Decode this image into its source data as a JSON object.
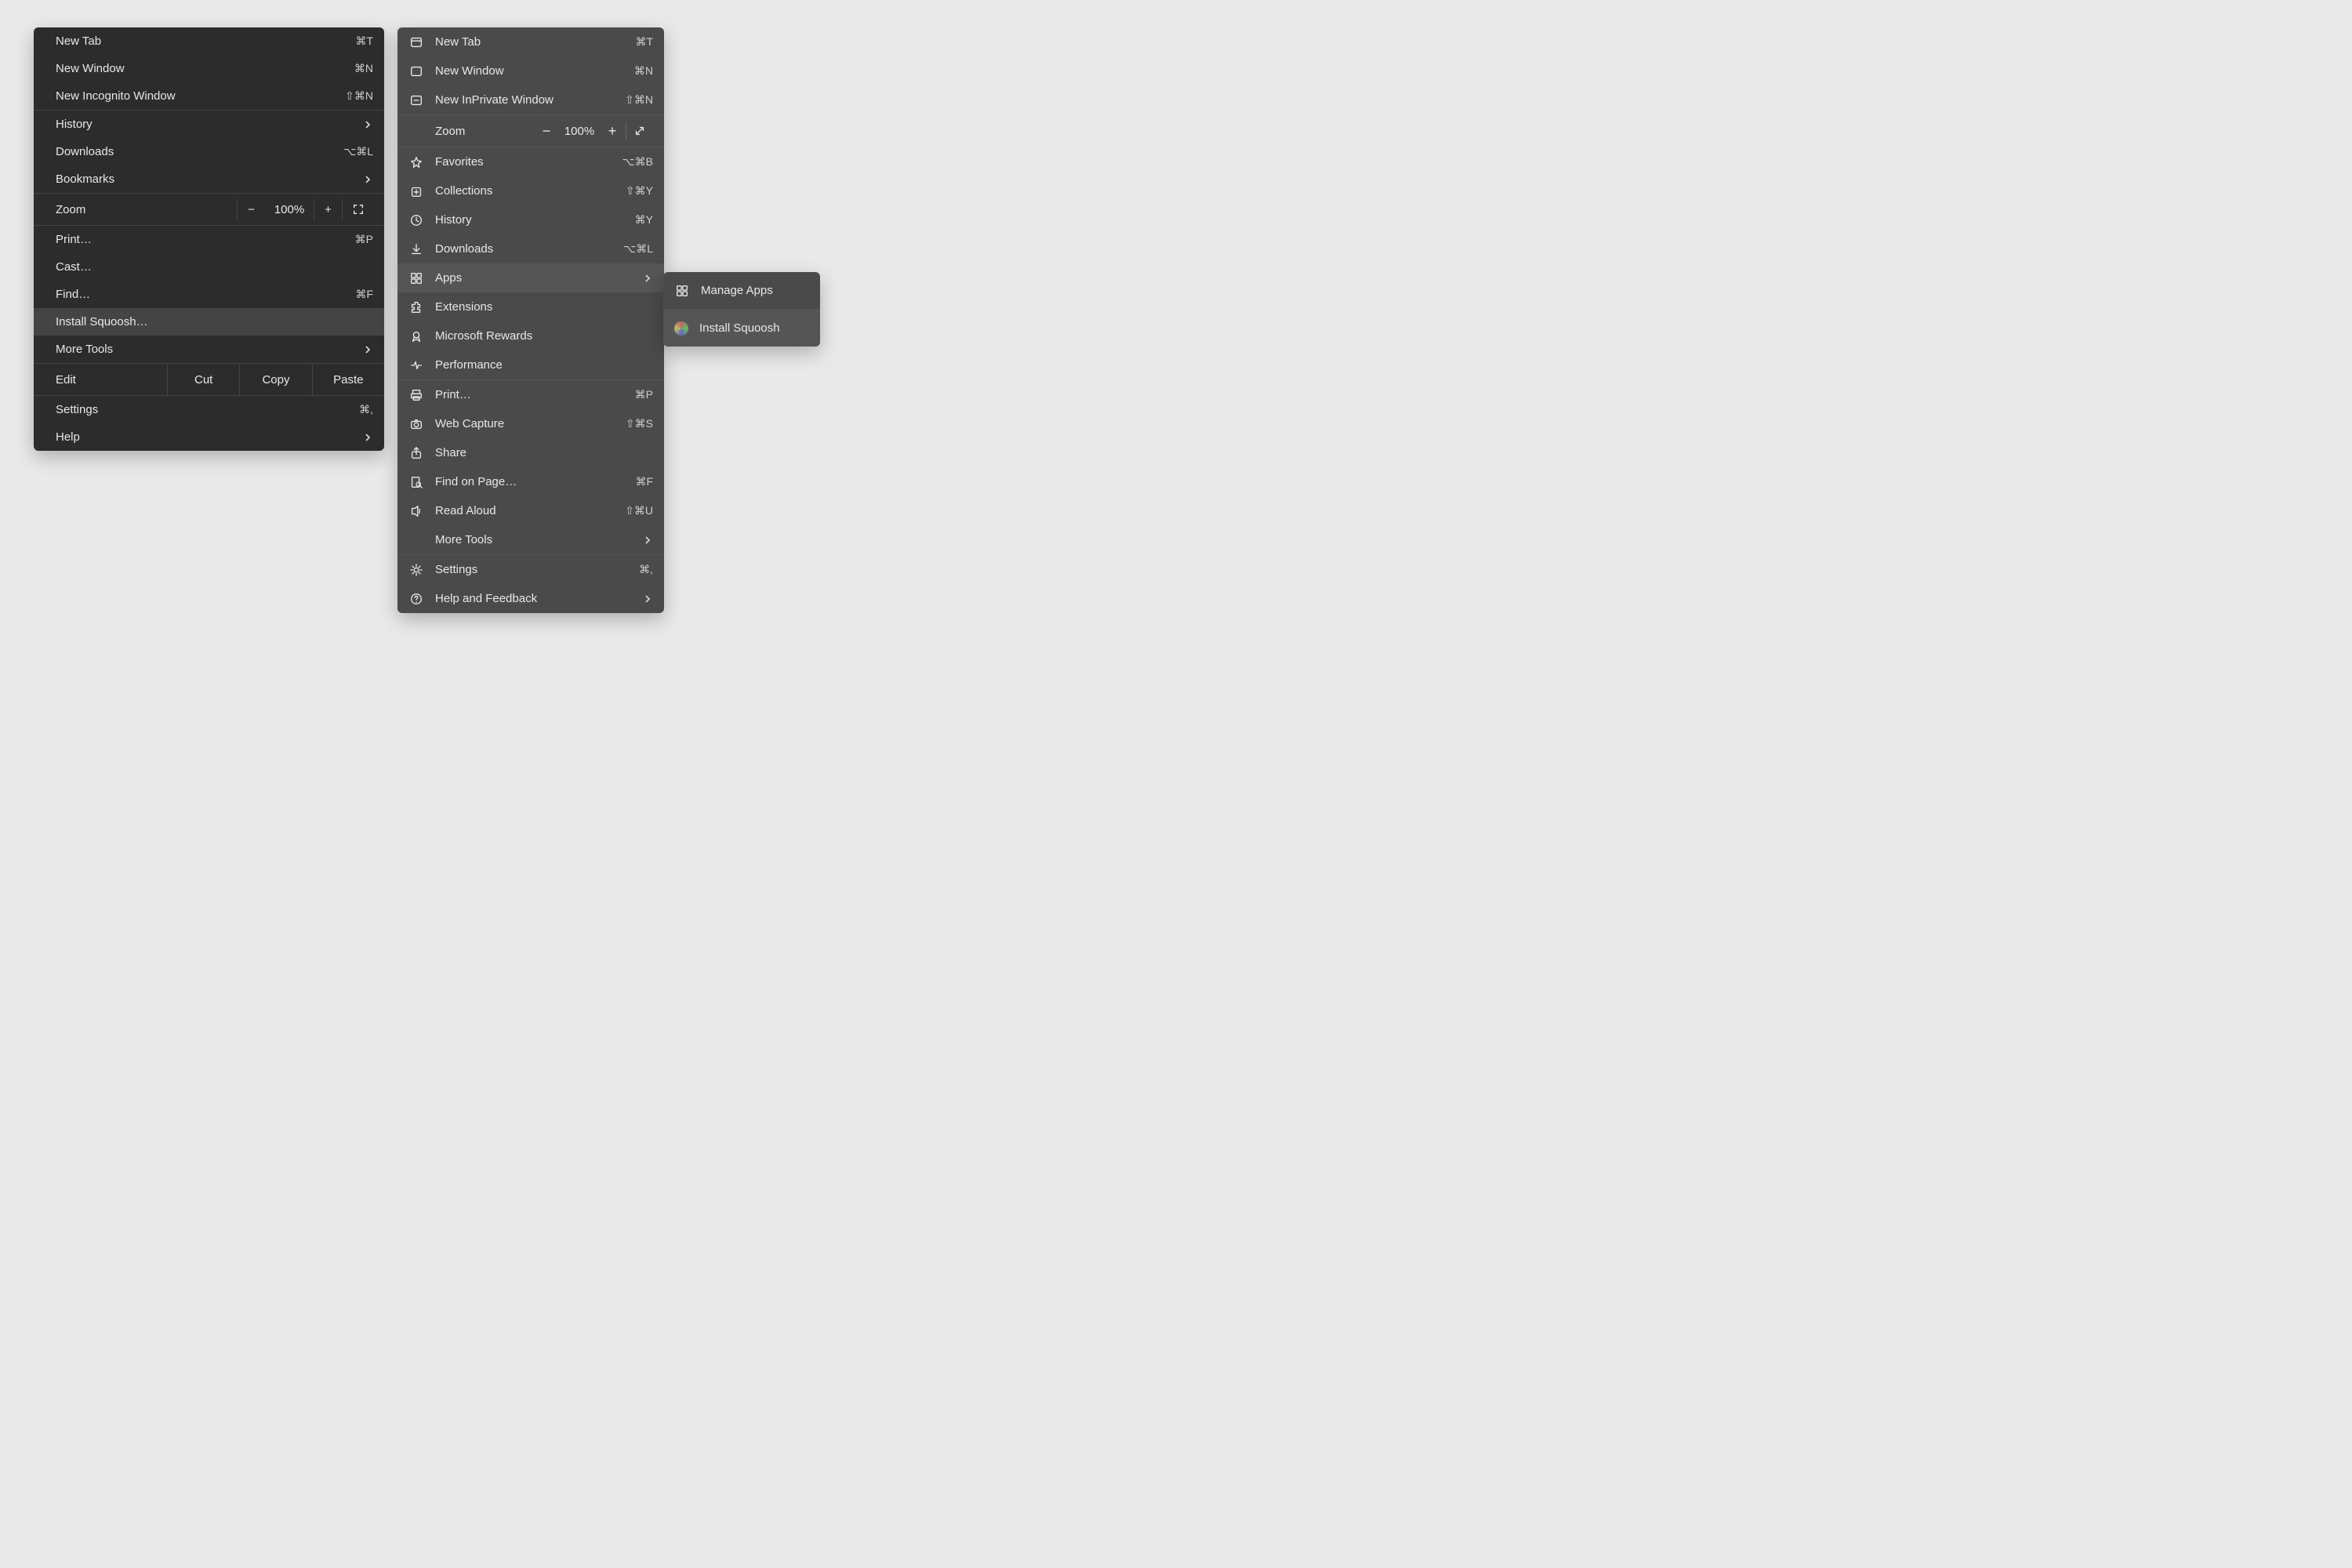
{
  "chrome": {
    "g1": [
      {
        "label": "New Tab",
        "short": "⌘T"
      },
      {
        "label": "New Window",
        "short": "⌘N"
      },
      {
        "label": "New Incognito Window",
        "short": "⇧⌘N"
      }
    ],
    "history": "History",
    "downloads": {
      "label": "Downloads",
      "short": "⌥⌘L"
    },
    "bookmarks": "Bookmarks",
    "zoom_label": "Zoom",
    "zoom_value": "100%",
    "print": {
      "label": "Print…",
      "short": "⌘P"
    },
    "cast": "Cast…",
    "find": {
      "label": "Find…",
      "short": "⌘F"
    },
    "install": "Install Squoosh…",
    "more_tools": "More Tools",
    "edit_label": "Edit",
    "cut": "Cut",
    "copy": "Copy",
    "paste": "Paste",
    "settings": {
      "label": "Settings",
      "short": "⌘,"
    },
    "help": "Help"
  },
  "edge": {
    "g1": [
      {
        "label": "New Tab",
        "short": "⌘T"
      },
      {
        "label": "New Window",
        "short": "⌘N"
      },
      {
        "label": "New InPrivate Window",
        "short": "⇧⌘N"
      }
    ],
    "zoom_label": "Zoom",
    "zoom_value": "100%",
    "g2": [
      {
        "label": "Favorites",
        "short": "⌥⌘B"
      },
      {
        "label": "Collections",
        "short": "⇧⌘Y"
      },
      {
        "label": "History",
        "short": "⌘Y"
      },
      {
        "label": "Downloads",
        "short": "⌥⌘L"
      }
    ],
    "apps": "Apps",
    "g3": [
      {
        "label": "Extensions"
      },
      {
        "label": "Microsoft Rewards"
      },
      {
        "label": "Performance"
      }
    ],
    "g4": [
      {
        "label": "Print…",
        "short": "⌘P"
      },
      {
        "label": "Web Capture",
        "short": "⇧⌘S"
      },
      {
        "label": "Share"
      },
      {
        "label": "Find on Page…",
        "short": "⌘F"
      },
      {
        "label": "Read Aloud",
        "short": "⇧⌘U"
      }
    ],
    "more_tools": "More Tools",
    "settings": {
      "label": "Settings",
      "short": "⌘,"
    },
    "help": "Help and Feedback"
  },
  "submenu": {
    "manage": "Manage Apps",
    "install": "Install Squoosh"
  }
}
